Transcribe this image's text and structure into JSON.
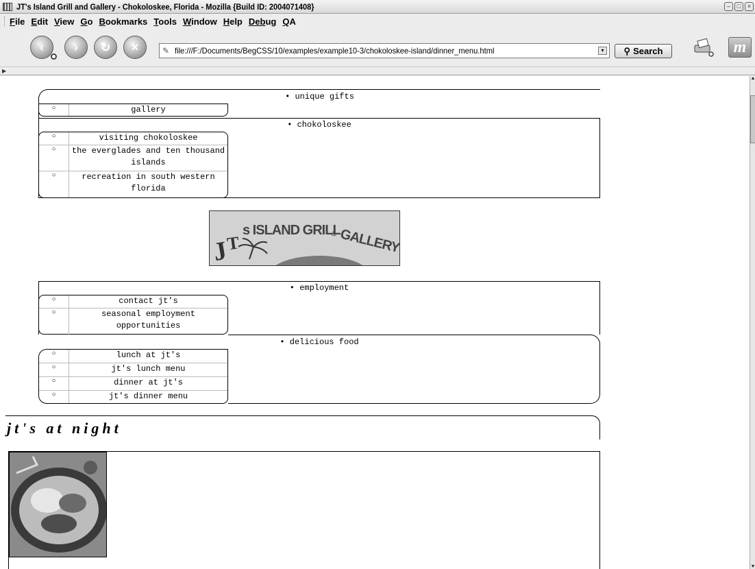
{
  "window": {
    "title": "JT's Island Grill and Gallery - Chokoloskee, Florida - Mozilla {Build ID: 2004071408}"
  },
  "menubar": {
    "items": [
      {
        "key": "F",
        "rest": "ile"
      },
      {
        "key": "E",
        "rest": "dit"
      },
      {
        "key": "V",
        "rest": "iew"
      },
      {
        "key": "G",
        "rest": "o"
      },
      {
        "key": "B",
        "rest": "ookmarks"
      },
      {
        "key": "T",
        "rest": "ools"
      },
      {
        "key": "W",
        "rest": "indow"
      },
      {
        "key": "H",
        "rest": "elp"
      },
      {
        "key": "Deb",
        "rest": "ug"
      },
      {
        "key": "Q",
        "rest": "A"
      }
    ]
  },
  "navbar": {
    "url": "file:///F:/Documents/BegCSS/10/examples/example10-3/chokoloskee-island/dinner_menu.html",
    "search_label": "Search"
  },
  "page": {
    "sections": [
      {
        "heading": "unique gifts",
        "items": [
          "gallery"
        ]
      },
      {
        "heading": "chokoloskee",
        "items": [
          "visiting chokoloskee",
          "the everglades and ten thousand islands",
          "recreation in south western florida"
        ]
      },
      {
        "heading": "employment",
        "items": [
          "contact jt's",
          "seasonal employment opportunities"
        ]
      },
      {
        "heading": "delicious food",
        "items": [
          "lunch at jt's",
          "jt's lunch menu",
          "dinner at jt's",
          "jt's dinner menu"
        ]
      }
    ],
    "logo_text": "JT's ISLAND GRILL & GALLERY",
    "night_heading": "jt's at night"
  },
  "colors": {
    "chrome_bg": "#ececec",
    "page_bg": "#ffffff",
    "border": "#000000"
  }
}
